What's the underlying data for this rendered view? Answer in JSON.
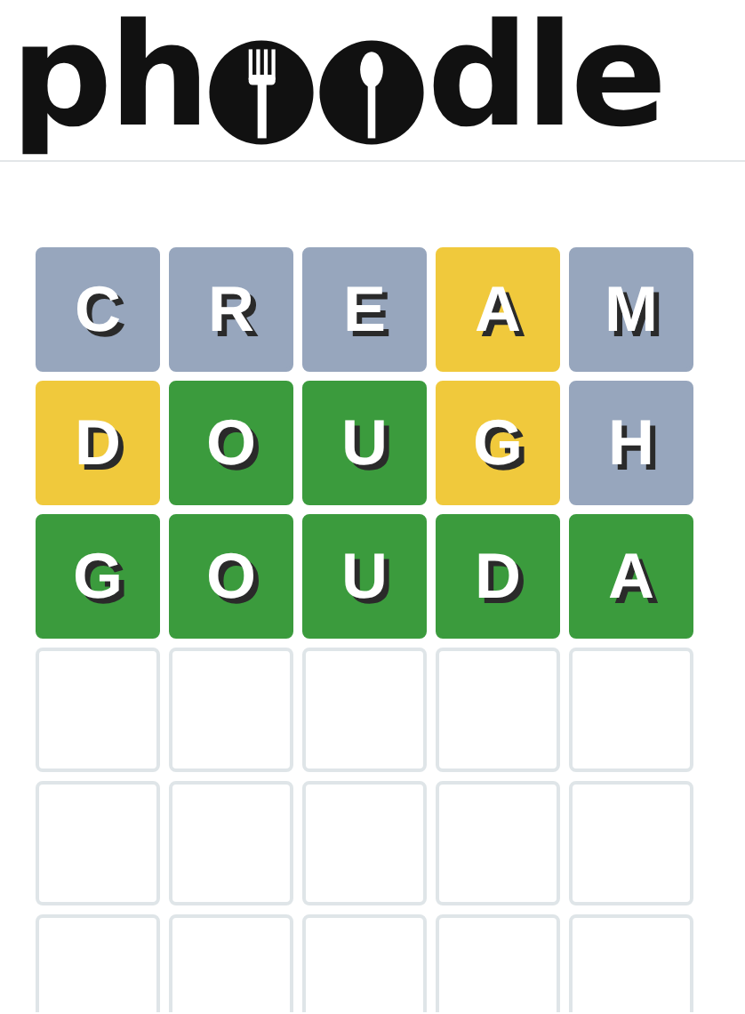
{
  "logo": {
    "before": "ph",
    "after": "dle"
  },
  "board": [
    [
      {
        "letter": "C",
        "color": "#97a6bd",
        "filled": true
      },
      {
        "letter": "R",
        "color": "#97a6bd",
        "filled": true
      },
      {
        "letter": "E",
        "color": "#97a6bd",
        "filled": true
      },
      {
        "letter": "A",
        "color": "#f0c93c",
        "filled": true
      },
      {
        "letter": "M",
        "color": "#97a6bd",
        "filled": true
      }
    ],
    [
      {
        "letter": "D",
        "color": "#f0c93c",
        "filled": true
      },
      {
        "letter": "O",
        "color": "#3b9b3d",
        "filled": true
      },
      {
        "letter": "U",
        "color": "#3b9b3d",
        "filled": true
      },
      {
        "letter": "G",
        "color": "#f0c93c",
        "filled": true
      },
      {
        "letter": "H",
        "color": "#97a6bd",
        "filled": true
      }
    ],
    [
      {
        "letter": "G",
        "color": "#3b9b3d",
        "filled": true
      },
      {
        "letter": "O",
        "color": "#3b9b3d",
        "filled": true
      },
      {
        "letter": "U",
        "color": "#3b9b3d",
        "filled": true
      },
      {
        "letter": "D",
        "color": "#3b9b3d",
        "filled": true
      },
      {
        "letter": "A",
        "color": "#3b9b3d",
        "filled": true
      }
    ],
    [
      {
        "filled": false
      },
      {
        "filled": false
      },
      {
        "filled": false
      },
      {
        "filled": false
      },
      {
        "filled": false
      }
    ],
    [
      {
        "filled": false
      },
      {
        "filled": false
      },
      {
        "filled": false
      },
      {
        "filled": false
      },
      {
        "filled": false
      }
    ],
    [
      {
        "filled": false
      },
      {
        "filled": false
      },
      {
        "filled": false
      },
      {
        "filled": false
      },
      {
        "filled": false
      }
    ]
  ]
}
